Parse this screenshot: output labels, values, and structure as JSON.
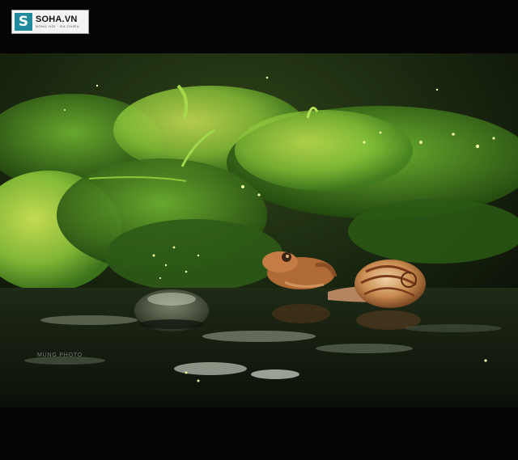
{
  "logo": {
    "name": "SOHA.VN",
    "letter": "S",
    "tagline": "NÓNG HỔI · ĐA CHIỀU"
  },
  "photo": {
    "watermark": "MUNG PHOTO",
    "colors": {
      "foliage": "#5ea628",
      "highlight": "#d8ef5a",
      "water": "#141c10",
      "frog": "#b06a35",
      "shell": "#c7894e"
    }
  }
}
